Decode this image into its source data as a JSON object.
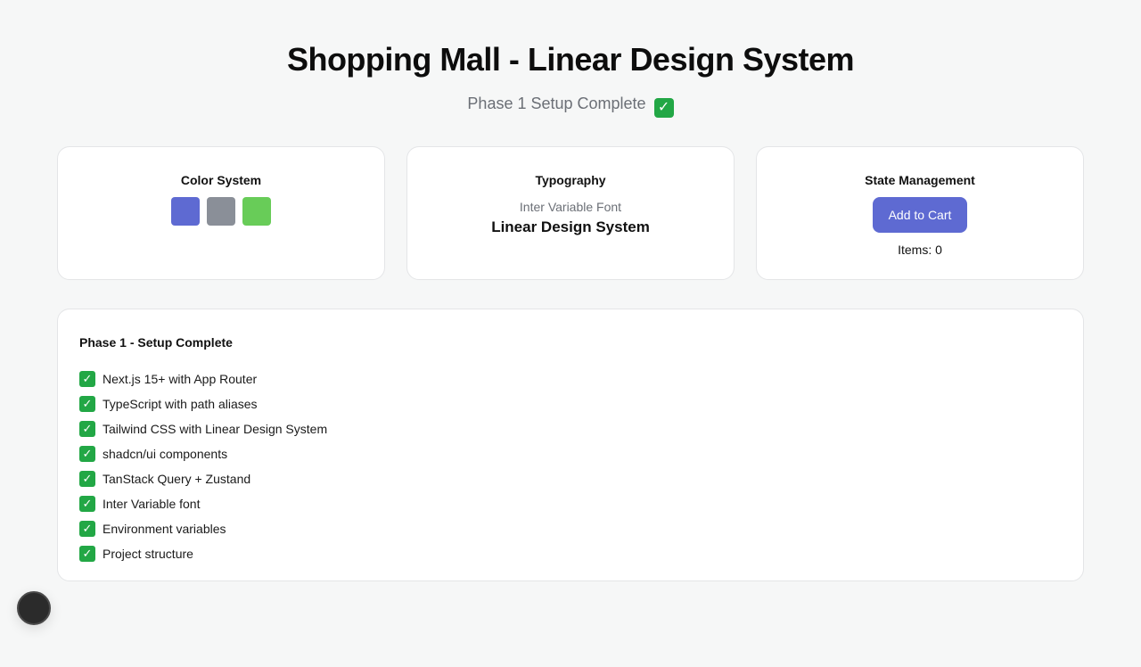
{
  "header": {
    "title": "Shopping Mall - Linear Design System",
    "subtitle": "Phase 1 Setup Complete",
    "subtitle_icon": "✓"
  },
  "color_card": {
    "title": "Color System",
    "swatches": [
      {
        "name": "primary",
        "color": "#5e6ad2"
      },
      {
        "name": "gray",
        "color": "#8a8f98"
      },
      {
        "name": "success",
        "color": "#68cc58"
      }
    ]
  },
  "typography_card": {
    "title": "Typography",
    "caption": "Inter Variable Font",
    "sample": "Linear Design System"
  },
  "state_card": {
    "title": "State Management",
    "button_label": "Add to Cart",
    "button_color": "#5e6ad2",
    "items_text": "Items: 0"
  },
  "checklist": {
    "title": "Phase 1 - Setup Complete",
    "icon": "✓",
    "items": [
      "Next.js 15+ with App Router",
      "TypeScript with path aliases",
      "Tailwind CSS with Linear Design System",
      "shadcn/ui components",
      "TanStack Query + Zustand",
      "Inter Variable font",
      "Environment variables",
      "Project structure"
    ]
  }
}
